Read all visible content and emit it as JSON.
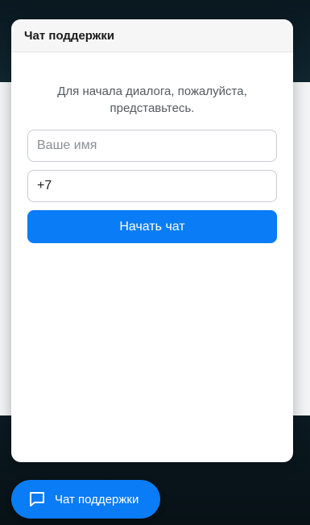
{
  "chat_window": {
    "title": "Чат поддержки",
    "intro_text": "Для начала диалога, пожалуйста, представьтесь.",
    "name_field": {
      "placeholder": "Ваше имя",
      "value": ""
    },
    "phone_field": {
      "placeholder": "",
      "value": "+7"
    },
    "start_button_label": "Начать чат"
  },
  "launcher": {
    "label": "Чат поддержки",
    "icon": "chat-bubble-icon"
  },
  "colors": {
    "accent": "#0a7cf5",
    "header_bg": "#f6f6f7",
    "page_dark": "#0a1820"
  }
}
